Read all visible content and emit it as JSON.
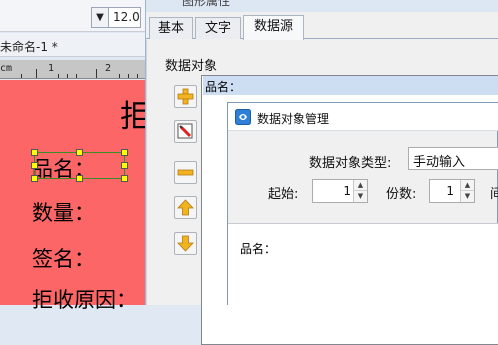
{
  "editor": {
    "font_size": "12.0",
    "document_tab": "未命名-1 *",
    "ruler": {
      "unit": "cm",
      "numbers": [
        "1",
        "2"
      ]
    },
    "canvas": {
      "big_char": "拒",
      "labels": [
        "品名：",
        "数量：",
        "签名：",
        "拒收原因："
      ]
    }
  },
  "properties_dialog": {
    "title": "图形属性",
    "tabs": [
      {
        "label": "基本",
        "active": false
      },
      {
        "label": "文字",
        "active": false
      },
      {
        "label": "数据源",
        "active": true
      }
    ],
    "data_objects_label": "数据对象",
    "data_objects_items": [
      "品名："
    ],
    "side_buttons": [
      "add-icon",
      "edit-icon",
      "remove-icon",
      "move-up-icon",
      "move-down-icon"
    ]
  },
  "manager_dialog": {
    "title": "数据对象管理",
    "type_label": "数据对象类型:",
    "type_value": "手动输入",
    "start_label": "起始:",
    "start_value": "1",
    "copies_label": "份数:",
    "copies_value": "1",
    "cut_label": "间",
    "content": "品名："
  },
  "colors": {
    "canvas_background": "#fd6666",
    "selection_handle": "#ffff00",
    "selected_item": "#cddef2"
  }
}
